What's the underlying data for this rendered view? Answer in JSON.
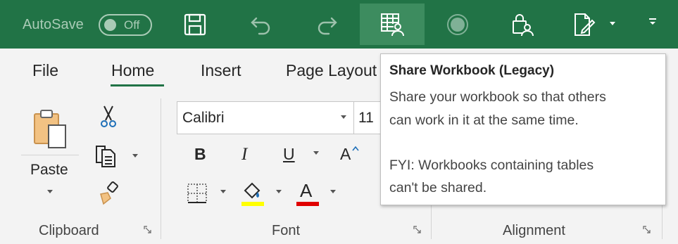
{
  "titlebar": {
    "autosave_label": "AutoSave",
    "autosave_state": "Off",
    "icons": [
      "save-icon",
      "undo-icon",
      "redo-icon",
      "share-workbook-icon",
      "record-macro-icon",
      "protect-share-icon",
      "track-changes-icon",
      "customize-toolbar-icon"
    ]
  },
  "tabs": [
    {
      "label": "File"
    },
    {
      "label": "Home",
      "active": true
    },
    {
      "label": "Insert"
    },
    {
      "label": "Page Layout"
    }
  ],
  "ribbon": {
    "clipboard": {
      "paste_label": "Paste",
      "group_label": "Clipboard"
    },
    "font": {
      "font_name": "Calibri",
      "font_size": "11",
      "bold": "B",
      "italic": "I",
      "underline": "U",
      "grow_font": "A",
      "font_color_glyph": "A",
      "group_label": "Font"
    },
    "alignment": {
      "group_label": "Alignment"
    }
  },
  "tooltip": {
    "title": "Share Workbook (Legacy)",
    "line1": "Share your workbook so that others",
    "line2": "can work in it at the same time.",
    "line3": "FYI: Workbooks containing tables",
    "line4": "can't be shared."
  },
  "colors": {
    "titlebar_bg": "#217346",
    "active_tab_underline": "#217346",
    "highlight_color": "#ffff00",
    "font_color": "#e00000"
  }
}
